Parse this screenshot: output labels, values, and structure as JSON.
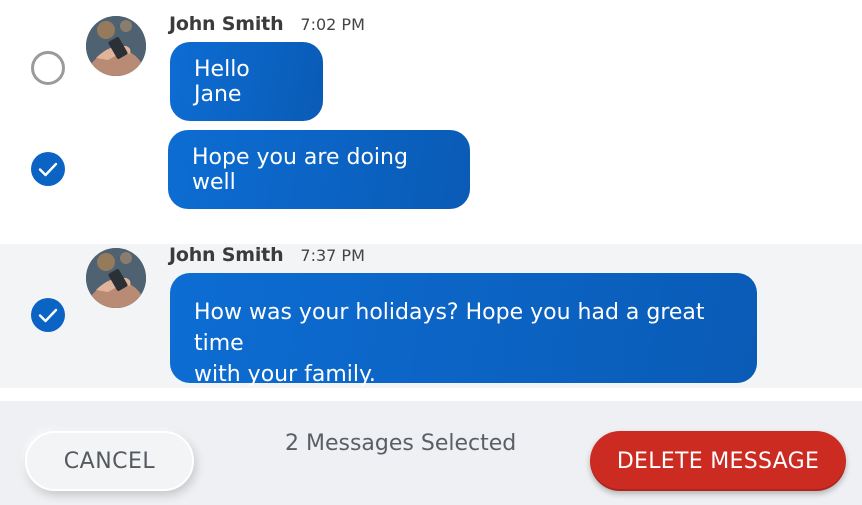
{
  "messages": {
    "group1": {
      "sender": "John Smith",
      "time": "7:02 PM",
      "items": [
        {
          "text": "Hello Jane",
          "selected": false
        },
        {
          "text": "Hope you are doing well",
          "selected": true
        }
      ]
    },
    "group2": {
      "sender": "John Smith",
      "time": "7:37 PM",
      "items": [
        {
          "text_line1": "How was your holidays? Hope you had a great time",
          "text_line2": "with your family.",
          "selected": true
        }
      ]
    }
  },
  "footer": {
    "cancel_label": "CANCEL",
    "selected_text": "2 Messages Selected",
    "delete_label": "DELETE MESSAGE"
  },
  "colors": {
    "bubble": "#0b63c4",
    "checkbox_checked": "#0b63c4",
    "delete_button": "#cc2b22",
    "selected_row_bg": "#f3f4f6",
    "footer_bg": "#eef0f3"
  },
  "icons": {
    "checked": "check-circle-icon",
    "unchecked": "empty-circle-icon",
    "avatar": "user-avatar"
  }
}
